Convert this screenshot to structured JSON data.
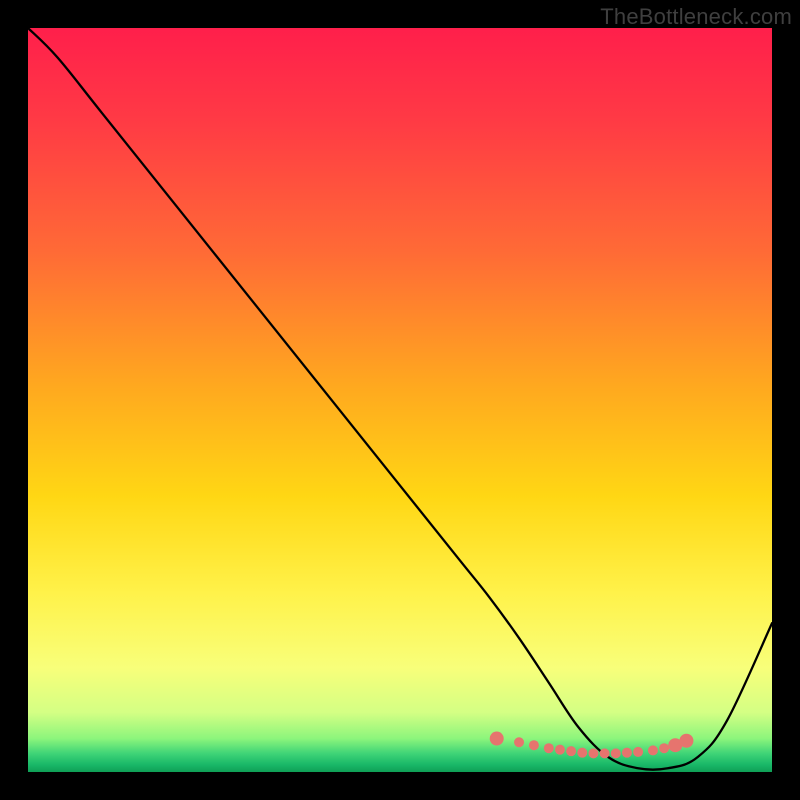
{
  "watermark": "TheBottleneck.com",
  "chart_data": {
    "type": "line",
    "title": "",
    "xlabel": "",
    "ylabel": "",
    "xlim": [
      0,
      100
    ],
    "ylim": [
      0,
      100
    ],
    "grid": false,
    "legend": false,
    "series": [
      {
        "name": "curve",
        "x": [
          0,
          4,
          10,
          20,
          30,
          40,
          50,
          58,
          62,
          66,
          70,
          74,
          78,
          82,
          86,
          90,
          94,
          100
        ],
        "y": [
          100,
          96,
          88.5,
          76,
          63.5,
          51,
          38.5,
          28.5,
          23.5,
          18,
          12,
          6,
          2,
          0.5,
          0.5,
          2,
          7,
          20
        ]
      }
    ],
    "marker_points": {
      "name": "cluster",
      "x": [
        63,
        66,
        68,
        70,
        71.5,
        73,
        74.5,
        76,
        77.5,
        79,
        80.5,
        82,
        84,
        85.5,
        87,
        88.5
      ],
      "y": [
        4.5,
        4,
        3.6,
        3.2,
        3.0,
        2.8,
        2.6,
        2.5,
        2.5,
        2.5,
        2.6,
        2.7,
        2.9,
        3.2,
        3.6,
        4.2
      ]
    },
    "gradient": {
      "stops": [
        {
          "offset": 0.0,
          "color": "#ff1f4b"
        },
        {
          "offset": 0.12,
          "color": "#ff3945"
        },
        {
          "offset": 0.3,
          "color": "#ff6a36"
        },
        {
          "offset": 0.48,
          "color": "#ffa81f"
        },
        {
          "offset": 0.63,
          "color": "#ffd714"
        },
        {
          "offset": 0.76,
          "color": "#fff24a"
        },
        {
          "offset": 0.86,
          "color": "#f8ff7a"
        },
        {
          "offset": 0.92,
          "color": "#d4ff84"
        },
        {
          "offset": 0.955,
          "color": "#8cf57c"
        },
        {
          "offset": 0.975,
          "color": "#3fd477"
        },
        {
          "offset": 0.99,
          "color": "#19b868"
        },
        {
          "offset": 1.0,
          "color": "#0f9f56"
        }
      ]
    },
    "marker_style": {
      "fill": "#e6746e",
      "radius_large": 7,
      "radius_small": 5
    },
    "line_style": {
      "stroke": "#000000",
      "width": 2.3
    }
  }
}
